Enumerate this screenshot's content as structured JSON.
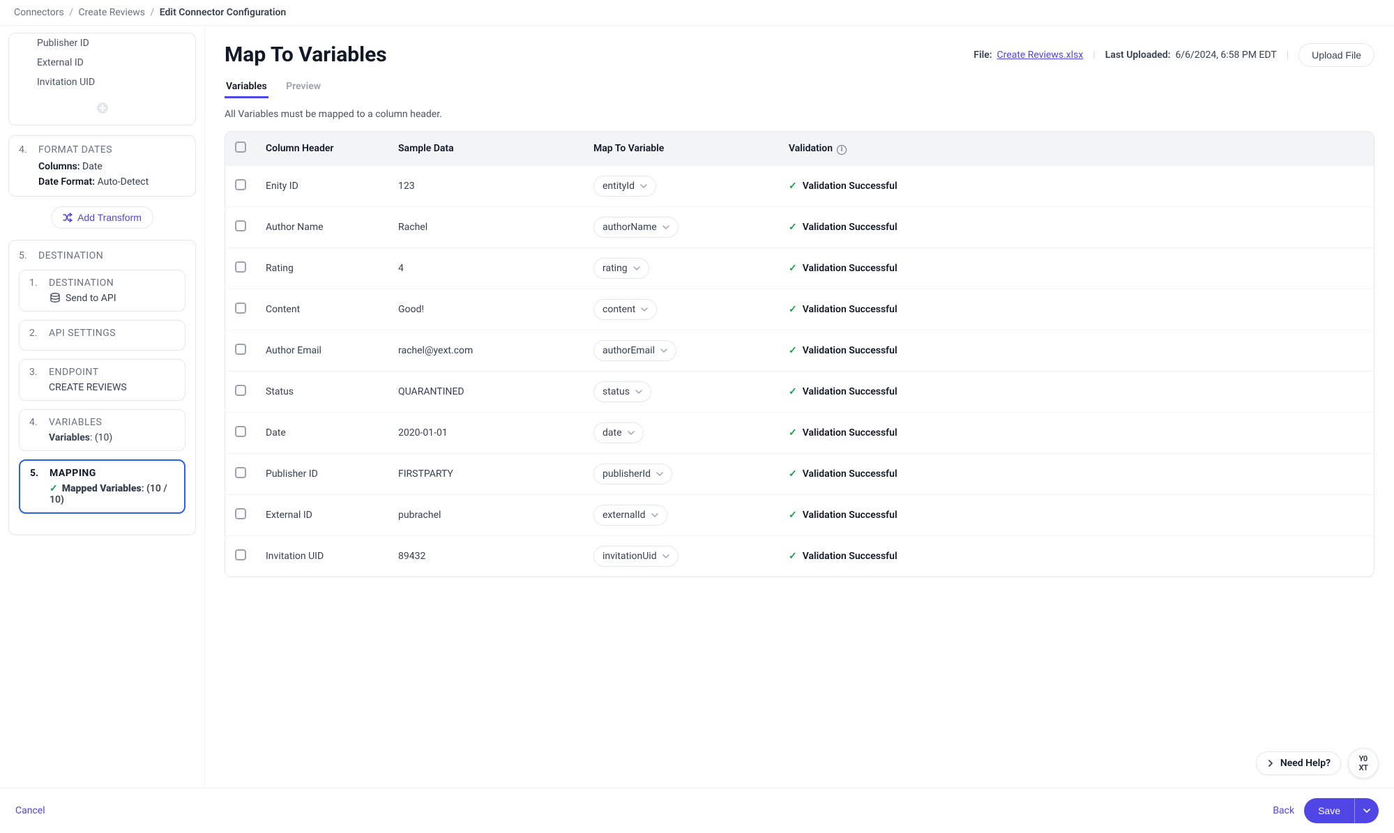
{
  "breadcrumb": {
    "level1": "Connectors",
    "level2": "Create Reviews",
    "current": "Edit Connector Configuration"
  },
  "sidebar": {
    "columns_panel": {
      "items": [
        "Publisher ID",
        "External ID",
        "Invitation UID"
      ]
    },
    "format_dates": {
      "num": "4.",
      "title": "FORMAT DATES",
      "columns_label": "Columns:",
      "columns_value": "Date",
      "date_format_label": "Date Format:",
      "date_format_value": "Auto-Detect"
    },
    "add_transform_label": "Add Transform",
    "destination": {
      "num": "5.",
      "title": "DESTINATION",
      "items": [
        {
          "num": "1.",
          "title": "DESTINATION",
          "body": "Send to API",
          "icon": true
        },
        {
          "num": "2.",
          "title": "API SETTINGS"
        },
        {
          "num": "3.",
          "title": "ENDPOINT",
          "body": "CREATE REVIEWS"
        },
        {
          "num": "4.",
          "title": "VARIABLES",
          "body_label": "Variables",
          "body_value": ": (10)"
        },
        {
          "num": "5.",
          "title": "MAPPING",
          "body_label": "Mapped Variables",
          "body_value": ": (10 / 10)",
          "check": true,
          "selected": true
        }
      ]
    }
  },
  "header": {
    "title": "Map To Variables",
    "file_label": "File:",
    "file_name": "Create Reviews.xlsx",
    "last_uploaded_label": "Last Uploaded:",
    "last_uploaded_value": "6/6/2024, 6:58 PM EDT",
    "upload_button": "Upload File"
  },
  "tabs": {
    "variables": "Variables",
    "preview": "Preview"
  },
  "hint": "All Variables must be mapped to a column header.",
  "table": {
    "headers": {
      "column": "Column Header",
      "sample": "Sample Data",
      "map": "Map To Variable",
      "validation": "Validation"
    },
    "rows": [
      {
        "column": "Enity ID",
        "sample": "123",
        "map": "entityId",
        "validation": "Validation Successful"
      },
      {
        "column": "Author Name",
        "sample": "Rachel",
        "map": "authorName",
        "validation": "Validation Successful"
      },
      {
        "column": "Rating",
        "sample": "4",
        "map": "rating",
        "validation": "Validation Successful"
      },
      {
        "column": "Content",
        "sample": "Good!",
        "map": "content",
        "validation": "Validation Successful"
      },
      {
        "column": "Author Email",
        "sample": "rachel@yext.com",
        "map": "authorEmail",
        "validation": "Validation Successful"
      },
      {
        "column": "Status",
        "sample": "QUARANTINED",
        "map": "status",
        "validation": "Validation Successful"
      },
      {
        "column": "Date",
        "sample": "2020-01-01",
        "map": "date",
        "validation": "Validation Successful"
      },
      {
        "column": "Publisher ID",
        "sample": "FIRSTPARTY",
        "map": "publisherId",
        "validation": "Validation Successful"
      },
      {
        "column": "External ID",
        "sample": "pubrachel",
        "map": "externalId",
        "validation": "Validation Successful"
      },
      {
        "column": "Invitation UID",
        "sample": "89432",
        "map": "invitationUid",
        "validation": "Validation Successful"
      }
    ]
  },
  "help": {
    "label": "Need Help?",
    "logo_top": "Y0",
    "logo_bottom": "XT"
  },
  "footer": {
    "cancel": "Cancel",
    "back": "Back",
    "save": "Save"
  }
}
